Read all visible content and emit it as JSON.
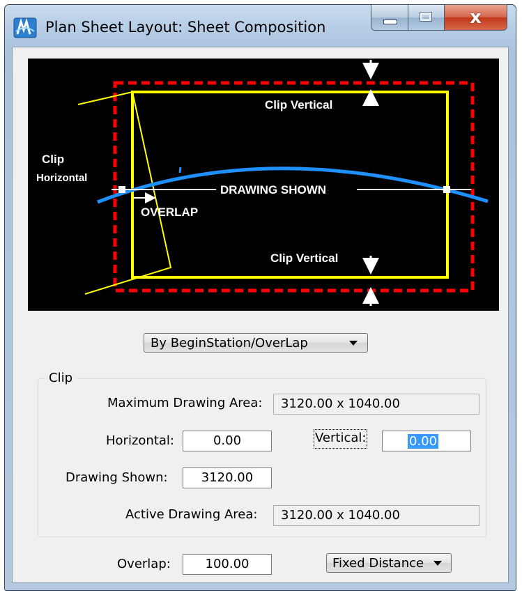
{
  "window": {
    "title": "Plan Sheet Layout: Sheet Composition",
    "close_glyph": "x"
  },
  "preview": {
    "clip_vertical_top": "Clip Vertical",
    "clip_vertical_bottom": "Clip Vertical",
    "clip_horizontal_line1": "Clip",
    "clip_horizontal_line2": "Horizontal",
    "drawing_shown": "DRAWING SHOWN",
    "overlap": "OVERLAP",
    "colors": {
      "background": "#000000",
      "clip_boundary": "#ff0000",
      "sheet_border": "#ffff00",
      "alignment": "#1e90ff",
      "annotation": "#ffffff"
    }
  },
  "mode_select": {
    "value": "By BeginStation/OverLap",
    "icon": "chevron-down-icon"
  },
  "clip_group": {
    "label": "Clip",
    "max_area_label": "Maximum Drawing Area:",
    "max_area_value": "3120.00 x  1040.00",
    "horizontal_label": "Horizontal:",
    "horizontal_value": "0.00",
    "vertical_label": "Vertical:",
    "vertical_value": "0.00",
    "drawing_shown_label": "Drawing Shown:",
    "drawing_shown_value": "3120.00",
    "active_area_label": "Active Drawing Area:",
    "active_area_value": "3120.00 x  1040.00"
  },
  "overlap": {
    "label": "Overlap:",
    "value": "100.00",
    "method_value": "Fixed Distance"
  }
}
